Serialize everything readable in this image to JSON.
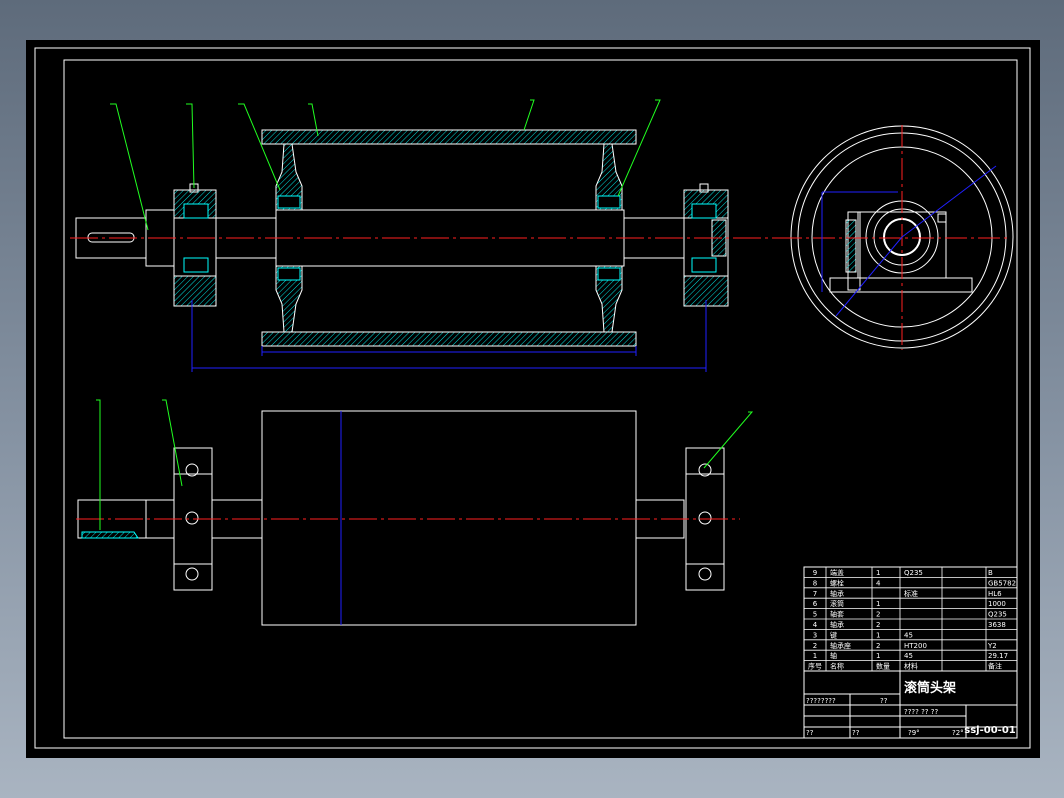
{
  "drawing": {
    "title": "滚筒头架",
    "drawing_number": "ssj-00-01",
    "sub_left": "????????",
    "sub_mid": "??",
    "sub_row2": "???? ?? ??",
    "sub_row3": "?9°",
    "sub_row3b": "?2°",
    "sub_row4": "??"
  },
  "bom": {
    "rows": [
      {
        "no": "9",
        "name": "端盖",
        "qty": "1",
        "mat": "Q235",
        "rem": "B"
      },
      {
        "no": "8",
        "name": "螺栓",
        "qty": "4",
        "mat": "",
        "rem": "GB5782"
      },
      {
        "no": "7",
        "name": "轴承",
        "qty": "",
        "mat": "标准",
        "rem": "HL6"
      },
      {
        "no": "6",
        "name": "滚筒",
        "qty": "1",
        "mat": "",
        "rem": "1000"
      },
      {
        "no": "5",
        "name": "轴套",
        "qty": "2",
        "mat": "",
        "rem": "Q235"
      },
      {
        "no": "4",
        "name": "轴承",
        "qty": "2",
        "mat": "",
        "rem": "3638"
      },
      {
        "no": "3",
        "name": "键",
        "qty": "1",
        "mat": "45",
        "rem": ""
      },
      {
        "no": "2",
        "name": "轴承座",
        "qty": "2",
        "mat": "HT200",
        "rem": "Y2"
      },
      {
        "no": "1",
        "name": "轴",
        "qty": "1",
        "mat": "45",
        "rem": "29.17"
      }
    ],
    "header": {
      "no": "序号",
      "name": "名称",
      "qty": "数量",
      "mat": "材料",
      "rem": "备注"
    }
  },
  "colors": {
    "background": "#000000",
    "outline": "#ffffff",
    "center_line": "#ff0000",
    "leader": "#00ff00",
    "dimension": "#0000ff",
    "hatch": "#00ffff",
    "desktop": "#7d8a9a"
  }
}
